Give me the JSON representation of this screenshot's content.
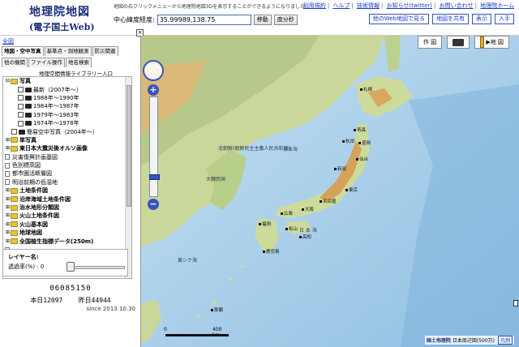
{
  "header": {
    "logo_line1": "地理院地図",
    "logo_line2": "(電子国土Web)",
    "notice": "地図の右クリックメニューから地理院地図3Dを表示することができるようになりました。",
    "links": [
      "利用規約",
      "ヘルプ",
      "技術情報",
      "お知らせ(twitter)",
      "お問い合わせ",
      "地理院ホーム"
    ],
    "coord_label": "中心緯度経度:",
    "coord_value": "35.99989,138.75",
    "move_button": "移動",
    "dms_button": "度分秒",
    "right_buttons": [
      "他のWeb地図で見る",
      "地図を共有",
      "表示",
      "入手"
    ]
  },
  "left_panel": {
    "all_link": "全図",
    "tabs_row1": [
      "地図・空中写真",
      "基準点・測地観測",
      "防災関連"
    ],
    "tabs_row2": [
      "他の機関",
      "ファイル操作",
      "地名検索"
    ],
    "library_link": "地理空間情報ライブラリー入口",
    "tree": [
      {
        "type": "folder",
        "exp": "−",
        "label": "写真",
        "bold": true,
        "indent": 0
      },
      {
        "type": "cam",
        "label": "最新（2007年〜）",
        "indent": 2
      },
      {
        "type": "cam",
        "label": "1988年〜1990年",
        "indent": 2
      },
      {
        "type": "cam",
        "label": "1984年〜1987年",
        "indent": 2
      },
      {
        "type": "cam",
        "label": "1979年〜1983年",
        "indent": 2
      },
      {
        "type": "cam",
        "label": "1974年〜1978年",
        "indent": 2
      },
      {
        "type": "cam",
        "label": "簡易空中写真（2004年〜）",
        "indent": 1
      },
      {
        "type": "folder",
        "exp": "+",
        "label": "単写真",
        "bold": true,
        "indent": 0
      },
      {
        "type": "folder",
        "exp": "+",
        "label": "東日本大震災後オルソ画像",
        "bold": true,
        "indent": 0
      },
      {
        "type": "doc",
        "label": "災害復興計画基図",
        "indent": 0
      },
      {
        "type": "doc",
        "label": "色別標高図",
        "indent": 0
      },
      {
        "type": "doc",
        "label": "都市圏活断層図",
        "indent": 0
      },
      {
        "type": "doc",
        "label": "明治前期の低湿地",
        "indent": 0
      },
      {
        "type": "folder",
        "exp": "+",
        "label": "土地条件図",
        "bold": true,
        "indent": 0
      },
      {
        "type": "folder",
        "exp": "+",
        "label": "沿岸海域土地条件図",
        "bold": true,
        "indent": 0
      },
      {
        "type": "folder",
        "exp": "+",
        "label": "治水地形分類図",
        "bold": true,
        "indent": 0
      },
      {
        "type": "folder",
        "exp": "+",
        "label": "火山土地条件図",
        "bold": true,
        "indent": 0
      },
      {
        "type": "folder",
        "exp": "+",
        "label": "火山基本図",
        "bold": true,
        "indent": 0
      },
      {
        "type": "folder",
        "exp": "+",
        "label": "地球地図",
        "bold": true,
        "indent": 0
      },
      {
        "type": "folder",
        "exp": "+",
        "label": "全国植生指標データ(250m)",
        "bold": true,
        "indent": 0
      },
      {
        "type": "doc",
        "label": "...",
        "indent": 0
      }
    ],
    "layer_name_label": "レイヤー名:",
    "opacity_label": "透過率(%) : 0",
    "counter": "06085150",
    "today_label": "本日",
    "today_value": "12097",
    "yesterday_label": "昨日",
    "yesterday_value": "44944",
    "since": "since 2013.10.30"
  },
  "map": {
    "tool_sakuzu": "作 図",
    "tool_map": "地 図",
    "labels": [
      {
        "text": "日本海",
        "name": "label-sea-of-japan"
      },
      {
        "text": "東シナ海",
        "name": "label-east-china-sea"
      },
      {
        "text": "北朝鮮(朝鮮民主主義人民共和国)",
        "name": "label-north-korea"
      },
      {
        "text": "大韓民国",
        "name": "label-south-korea"
      },
      {
        "text": "日 本 海",
        "name": "label-japan-sea-2"
      }
    ],
    "cities": [
      "札幌",
      "青森",
      "秋田",
      "盛岡",
      "仙台",
      "新潟",
      "東京",
      "名古屋",
      "大阪",
      "広島",
      "福岡",
      "鹿児島",
      "那覇",
      "松山",
      "高知"
    ],
    "scale_zero": "0",
    "scale_max": "400 km",
    "attribution_gsi": "国土地理院",
    "attribution_text": "日本周辺図(500万)",
    "attribution_legend": "凡例"
  }
}
